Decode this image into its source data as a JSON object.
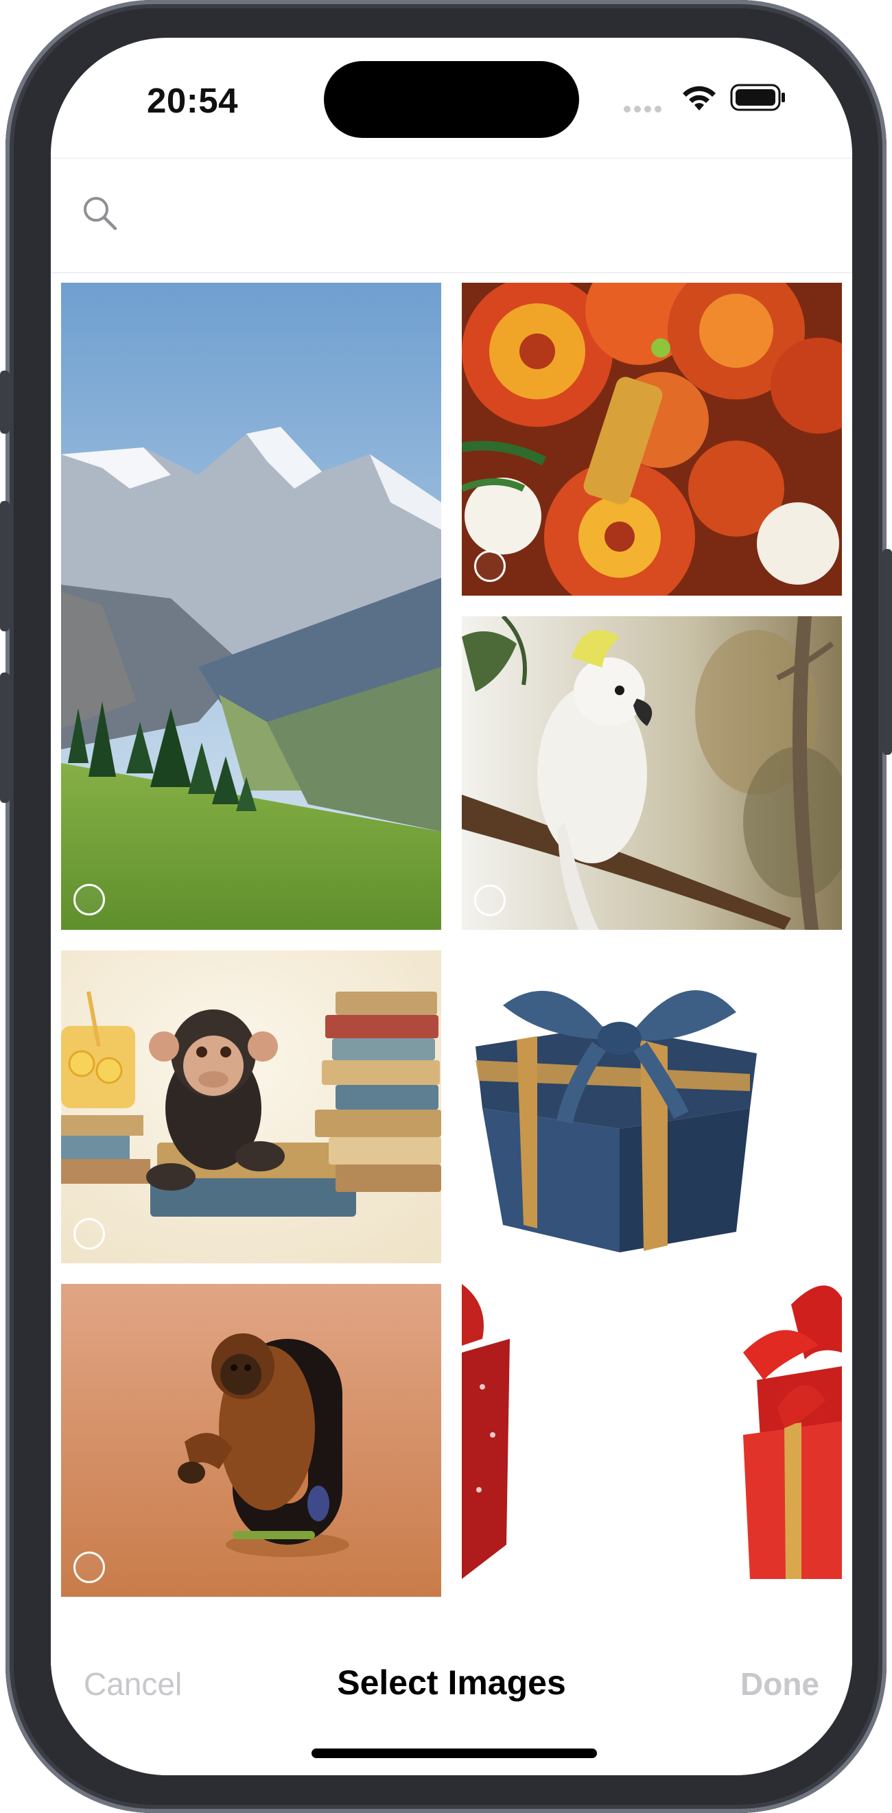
{
  "status_bar": {
    "time": "20:54"
  },
  "search": {
    "placeholder": "",
    "value": ""
  },
  "photos": [
    {
      "name": "mountain-valley-photo"
    },
    {
      "name": "orange-chrysanthemums-photo"
    },
    {
      "name": "cockatoo-photo"
    },
    {
      "name": "chimp-with-books-photo"
    },
    {
      "name": "blue-gift-box-photo"
    },
    {
      "name": "orangutan-zero-photo"
    },
    {
      "name": "red-gift-boxes-photo"
    }
  ],
  "bottom_bar": {
    "cancel_label": "Cancel",
    "title": "Select Images",
    "done_label": "Done"
  },
  "colors": {
    "disabled_text": "#c7c7cc",
    "title_text": "#000000",
    "device_frame": "#2b2d33"
  }
}
